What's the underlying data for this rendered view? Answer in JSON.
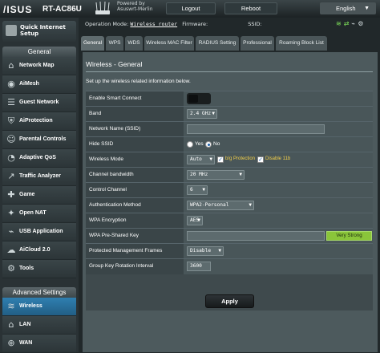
{
  "header": {
    "logo": "/ISUS",
    "model": "RT-AC86U",
    "powered_line1": "Powered by",
    "powered_line2": "Asuswrt-Merlin",
    "logout_label": "Logout",
    "reboot_label": "Reboot",
    "language": "English"
  },
  "sidebar": {
    "qis_label_1": "Quick Internet",
    "qis_label_2": "Setup",
    "general_header": "General",
    "general_items": [
      {
        "label": "Network Map",
        "icon": "network-map-icon"
      },
      {
        "label": "AiMesh",
        "icon": "aimesh-icon"
      },
      {
        "label": "Guest Network",
        "icon": "guest-network-icon"
      },
      {
        "label": "AiProtection",
        "icon": "shield-icon"
      },
      {
        "label": "Parental Controls",
        "icon": "parental-icon"
      },
      {
        "label": "Adaptive QoS",
        "icon": "qos-icon"
      },
      {
        "label": "Traffic Analyzer",
        "icon": "traffic-icon"
      },
      {
        "label": "Game",
        "icon": "gamepad-icon"
      },
      {
        "label": "Open NAT",
        "icon": "open-nat-icon"
      },
      {
        "label": "USB Application",
        "icon": "usb-icon"
      },
      {
        "label": "AiCloud 2.0",
        "icon": "cloud-icon"
      },
      {
        "label": "Tools",
        "icon": "tools-icon"
      }
    ],
    "advanced_header": "Advanced Settings",
    "advanced_items": [
      {
        "label": "Wireless",
        "icon": "wifi-icon",
        "active": true
      },
      {
        "label": "LAN",
        "icon": "lan-icon"
      },
      {
        "label": "WAN",
        "icon": "wan-icon"
      }
    ]
  },
  "status_bar": {
    "operation_mode_label": "Operation Mode:",
    "operation_mode_value": "Wireless router",
    "firmware_label": "Firmware:",
    "ssid_label": "SSID:"
  },
  "tabs": [
    {
      "label": "General",
      "active": true
    },
    {
      "label": "WPS"
    },
    {
      "label": "WDS"
    },
    {
      "label": "Wireless MAC Filter"
    },
    {
      "label": "RADIUS Setting"
    },
    {
      "label": "Professional"
    },
    {
      "label": "Roaming Block List"
    }
  ],
  "page": {
    "title": "Wireless - General",
    "description": "Set up the wireless related information below."
  },
  "form": {
    "smart_connect_label": "Enable Smart Connect",
    "band_label": "Band",
    "band_value": "2.4 GHz",
    "ssid_label": "Network Name (SSID)",
    "ssid_value": "",
    "hide_ssid_label": "Hide SSID",
    "hide_yes": "Yes",
    "hide_no": "No",
    "wireless_mode_label": "Wireless Mode",
    "wireless_mode_value": "Auto",
    "bg_protection_label": "b/g Protection",
    "disable_11b_label": "Disable 11b",
    "channel_bw_label": "Channel bandwidth",
    "channel_bw_value": "20 MHz",
    "control_channel_label": "Control Channel",
    "control_channel_value": "6",
    "auth_method_label": "Authentication Method",
    "auth_method_value": "WPA2-Personal",
    "wpa_enc_label": "WPA Encryption",
    "wpa_enc_value": "AES",
    "psk_label": "WPA Pre-Shared Key",
    "psk_strength": "Very Strong",
    "pmf_label": "Protected Management Frames",
    "pmf_value": "Disable",
    "gk_rotation_label": "Group Key Rotation Interval",
    "gk_rotation_value": "3600"
  },
  "apply_label": "Apply",
  "colors": {
    "accent": "#2f7fb0",
    "strength": "#8ac53a",
    "warn_label": "#f3d04a"
  }
}
